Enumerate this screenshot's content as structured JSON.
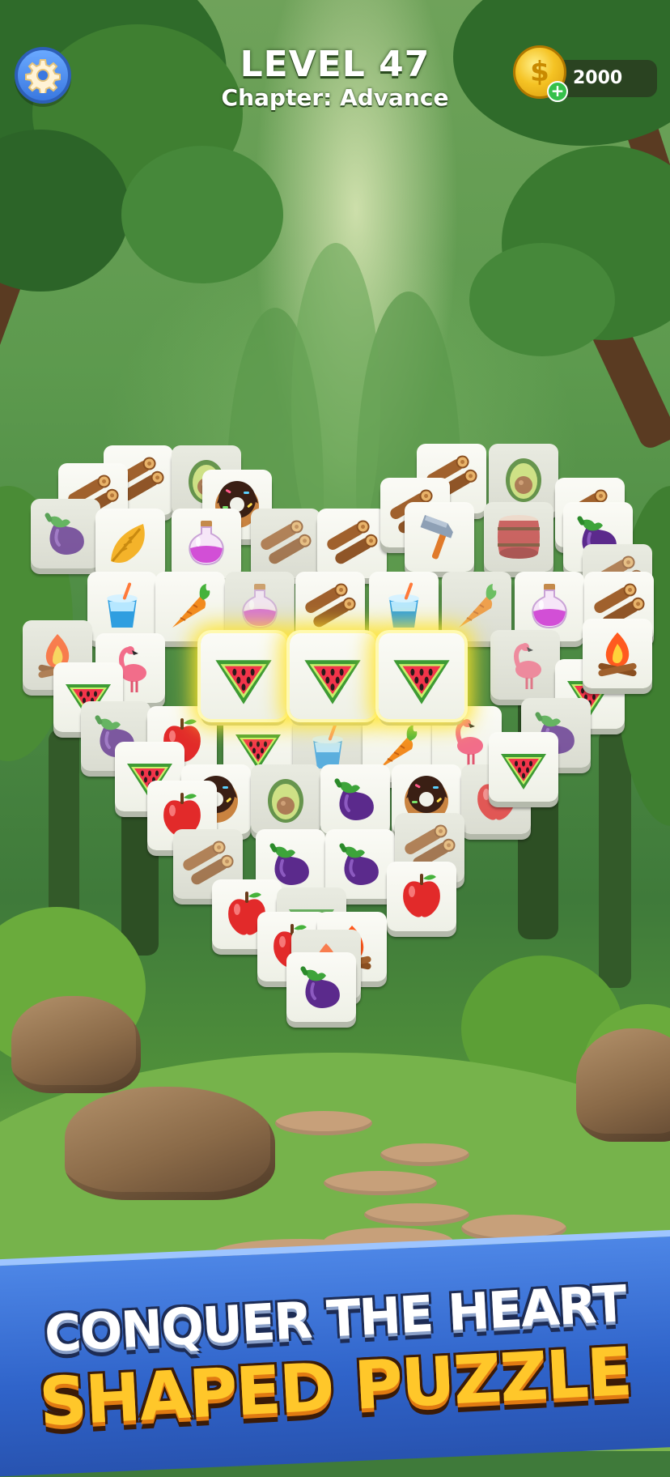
{
  "hud": {
    "level": "LEVEL 47",
    "chapter": "Chapter: Advance",
    "coins": "2000",
    "settings_icon": "gear-icon",
    "coin_icon": "coin-icon",
    "add_coins_icon": "plus-icon"
  },
  "board": {
    "shape": "heart",
    "selected_tiles": [
      "watermelon",
      "watermelon",
      "watermelon"
    ],
    "tiles": [
      "logs",
      "avocado",
      "logs",
      "donut",
      "eggplant",
      "leaf",
      "potion",
      "logs",
      "logs",
      "logs",
      "avocado",
      "logs",
      "hammer",
      "barrel",
      "logs",
      "eggplant",
      "logs",
      "cup",
      "carrot",
      "potion",
      "logs",
      "cup",
      "carrot",
      "potion",
      "logs",
      "campfire",
      "flamingo",
      "watermelon",
      "flamingo",
      "watermelon",
      "campfire",
      "eggplant",
      "apple",
      "watermelon",
      "cup",
      "carrot",
      "flamingo",
      "eggplant",
      "watermelon",
      "donut",
      "avocado",
      "eggplant",
      "donut",
      "apple",
      "watermelon",
      "apple",
      "logs",
      "eggplant",
      "eggplant",
      "logs",
      "apple",
      "apple",
      "watermelon",
      "apple",
      "campfire",
      "campfire",
      "eggplant"
    ]
  },
  "banner": {
    "line1": "CONQUER THE HEART",
    "line2": "SHAPED PUZZLE"
  },
  "colors": {
    "banner_blue": "#2f63c9",
    "headline_yellow": "#ffc72a",
    "selection_glow": "#ffe42b",
    "settings_blue": "#3a78e0"
  }
}
